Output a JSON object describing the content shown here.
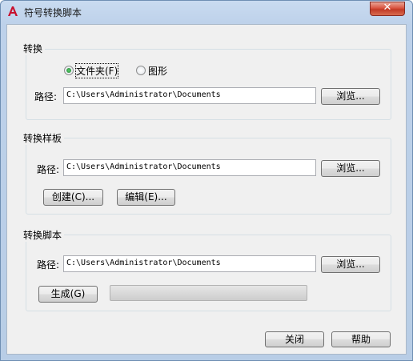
{
  "window": {
    "title": "符号转换脚本",
    "close_label": "✕"
  },
  "convert_group": {
    "label": "转换",
    "radio_folder": "文件夹(F)",
    "radio_drawing": "图形",
    "selected": "folder",
    "path_label": "路径:",
    "path_value": "C:\\Users\\Administrator\\Documents",
    "browse_label": "浏览..."
  },
  "template_group": {
    "label": "转换样板",
    "path_label": "路径:",
    "path_value": "C:\\Users\\Administrator\\Documents",
    "browse_label": "浏览...",
    "create_label": "创建(C)...",
    "edit_label": "编辑(E)..."
  },
  "script_group": {
    "label": "转换脚本",
    "path_label": "路径:",
    "path_value": "C:\\Users\\Administrator\\Documents",
    "browse_label": "浏览...",
    "generate_label": "生成(G)",
    "progress": 0
  },
  "footer": {
    "close_label": "关闭",
    "help_label": "帮助"
  },
  "colors": {
    "app_icon": "#c8102e",
    "title_bar": "#bdd1ea",
    "dialog_bg": "#f0f0f0"
  }
}
